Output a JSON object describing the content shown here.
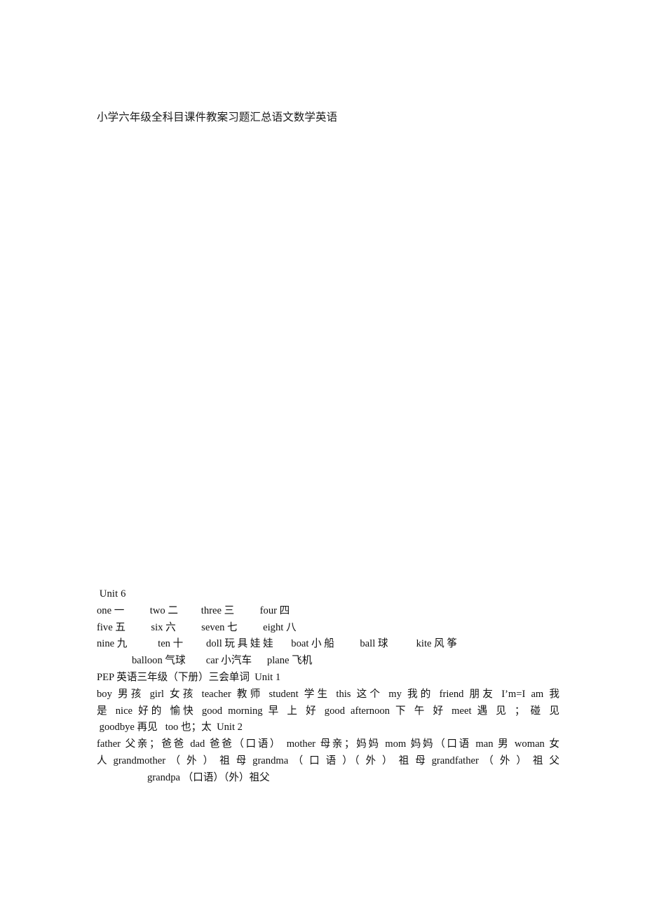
{
  "document": {
    "title": "小学六年级全科目课件教案习题汇总语文数学英语",
    "body": {
      "unit6_heading": " Unit 6",
      "numbers_line1": "one 一          two 二         three 三          four 四",
      "numbers_line2": "five 五          six 六          seven 七          eight 八",
      "toys_line": "nine 九            ten 十         doll 玩 具 娃 娃       boat 小 船          ball 球           kite 风 筝",
      "toys_line2": "balloon 气球        car 小汽车      plane 飞机",
      "pep_heading": "PEP 英语三年级（下册）三会单词  Unit 1",
      "unit1_line1": "boy 男孩  girl 女孩  teacher 教师  student 学生 this 这个     my 我的 friend 朋友  I’m=I am 我",
      "unit1_line2": "是 nice 好的 愉快          good morning 早 上 好 good afternoon 下 午 好  meet 遇 见 ； 碰 见",
      "unit1_line3": " goodbye 再见   too 也；太  Unit 2",
      "unit2_line1": "father 父亲；爸爸 dad 爸爸（口语） mother 母亲；妈妈 mom 妈妈（口语 man 男 woman 女",
      "unit2_line2": "人 grandmother （ 外 ） 祖 母     grandma （ 口 语 ）（ 外 ） 祖 母 grandfather （ 外 ） 祖 父",
      "unit2_line3": "grandpa （口语）（外）祖父"
    }
  },
  "vocabulary": {
    "unit6": {
      "heading": "Unit 6",
      "entries": [
        {
          "en": "one",
          "zh": "一"
        },
        {
          "en": "two",
          "zh": "二"
        },
        {
          "en": "three",
          "zh": "三"
        },
        {
          "en": "four",
          "zh": "四"
        },
        {
          "en": "five",
          "zh": "五"
        },
        {
          "en": "six",
          "zh": "六"
        },
        {
          "en": "seven",
          "zh": "七"
        },
        {
          "en": "eight",
          "zh": "八"
        },
        {
          "en": "nine",
          "zh": "九"
        },
        {
          "en": "ten",
          "zh": "十"
        },
        {
          "en": "doll",
          "zh": "玩具娃娃"
        },
        {
          "en": "boat",
          "zh": "小船"
        },
        {
          "en": "ball",
          "zh": "球"
        },
        {
          "en": "kite",
          "zh": "风筝"
        },
        {
          "en": "balloon",
          "zh": "气球"
        },
        {
          "en": "car",
          "zh": "小汽车"
        },
        {
          "en": "plane",
          "zh": "飞机"
        }
      ]
    },
    "pep_grade3_vol2": {
      "heading": "PEP 英语三年级（下册）三会单词",
      "unit1": {
        "label": "Unit 1",
        "entries": [
          {
            "en": "boy",
            "zh": "男孩"
          },
          {
            "en": "girl",
            "zh": "女孩"
          },
          {
            "en": "teacher",
            "zh": "教师"
          },
          {
            "en": "student",
            "zh": "学生"
          },
          {
            "en": "this",
            "zh": "这个"
          },
          {
            "en": "my",
            "zh": "我的"
          },
          {
            "en": "friend",
            "zh": "朋友"
          },
          {
            "en": "I’m=I am",
            "zh": "我是"
          },
          {
            "en": "nice",
            "zh": "好的 愉快"
          },
          {
            "en": "good morning",
            "zh": "早上好"
          },
          {
            "en": "good afternoon",
            "zh": "下午好"
          },
          {
            "en": "meet",
            "zh": "遇见；碰见"
          },
          {
            "en": "goodbye",
            "zh": "再见"
          },
          {
            "en": "too",
            "zh": "也；太"
          }
        ]
      },
      "unit2": {
        "label": "Unit 2",
        "entries": [
          {
            "en": "father",
            "zh": "父亲；爸爸"
          },
          {
            "en": "dad",
            "zh": "爸爸（口语）"
          },
          {
            "en": "mother",
            "zh": "母亲；妈妈"
          },
          {
            "en": "mom",
            "zh": "妈妈（口语"
          },
          {
            "en": "man",
            "zh": "男"
          },
          {
            "en": "woman",
            "zh": "女人"
          },
          {
            "en": "grandmother",
            "zh": "（外）祖母"
          },
          {
            "en": "grandma",
            "zh": "（口语）（外）祖母"
          },
          {
            "en": "grandfather",
            "zh": "（外）祖父"
          },
          {
            "en": "grandpa",
            "zh": "（口语）（外）祖父"
          }
        ]
      }
    }
  }
}
